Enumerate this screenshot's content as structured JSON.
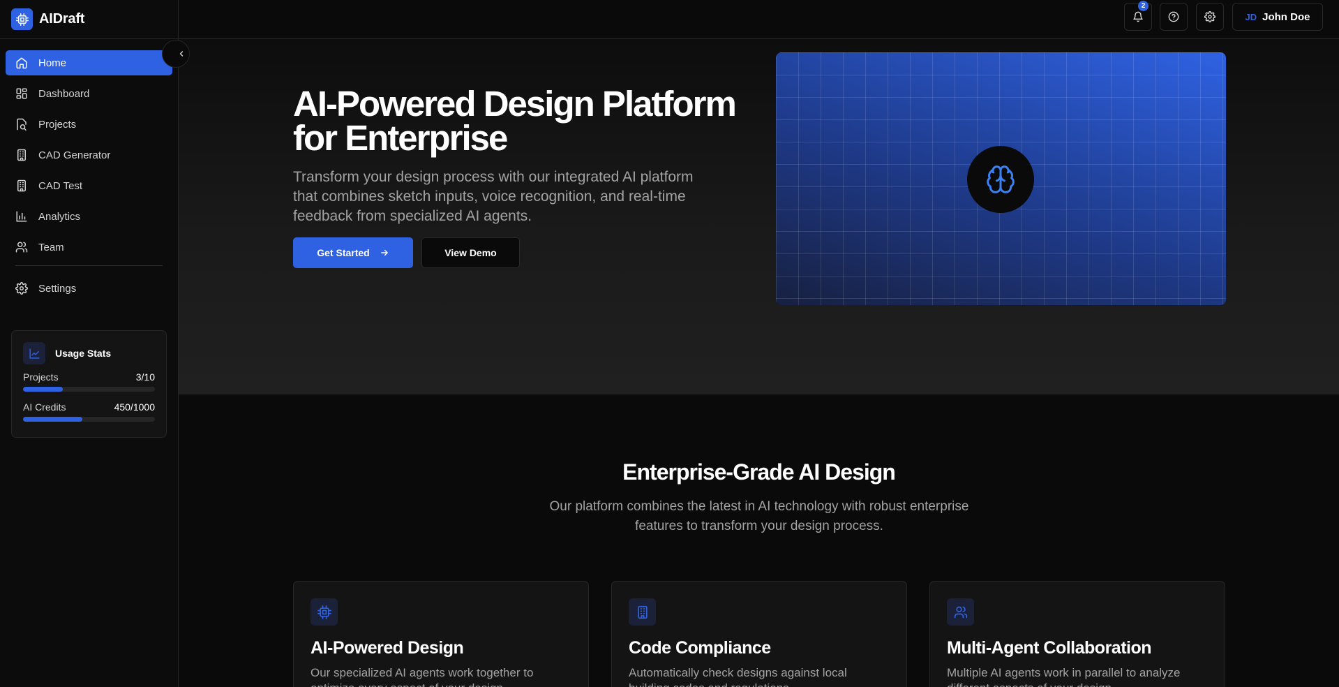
{
  "app": {
    "name": "AIDraft"
  },
  "nav": {
    "items": [
      {
        "label": "Home",
        "icon": "home-icon"
      },
      {
        "label": "Dashboard",
        "icon": "dashboard-icon"
      },
      {
        "label": "Projects",
        "icon": "projects-icon"
      },
      {
        "label": "CAD Generator",
        "icon": "building-icon"
      },
      {
        "label": "CAD Test",
        "icon": "building-icon"
      },
      {
        "label": "Analytics",
        "icon": "bar-chart-icon"
      },
      {
        "label": "Team",
        "icon": "users-icon"
      }
    ],
    "settings": {
      "label": "Settings",
      "icon": "gear-icon"
    }
  },
  "usage": {
    "title": "Usage Stats",
    "projects_label": "Projects",
    "projects_value": "3/10",
    "projects_fraction": 0.3,
    "credits_label": "AI Credits",
    "credits_value": "450/1000",
    "credits_fraction": 0.45
  },
  "topbar": {
    "notification_count": "2",
    "user_initials": "JD",
    "user_name": "John Doe"
  },
  "hero": {
    "title": "AI-Powered Design Platform for Enterprise",
    "subtitle": "Transform your design process with our integrated AI platform that combines sketch inputs, voice recognition, and real-time feedback from specialized AI agents.",
    "primary_button": "Get Started",
    "secondary_button": "View Demo"
  },
  "features": {
    "title": "Enterprise-Grade AI Design",
    "subtitle": "Our platform combines the latest in AI technology with robust enterprise features to transform your design process.",
    "cards": [
      {
        "title": "AI-Powered Design",
        "desc": "Our specialized AI agents work together to optimize every aspect of your design.",
        "icon": "cpu-icon"
      },
      {
        "title": "Code Compliance",
        "desc": "Automatically check designs against local building codes and regulations.",
        "icon": "building-icon"
      },
      {
        "title": "Multi-Agent Collaboration",
        "desc": "Multiple AI agents work in parallel to analyze different aspects of your design.",
        "icon": "users-icon"
      }
    ]
  },
  "colors": {
    "accent": "#2f62e3",
    "background": "#0a0a0a",
    "card": "#141414"
  }
}
